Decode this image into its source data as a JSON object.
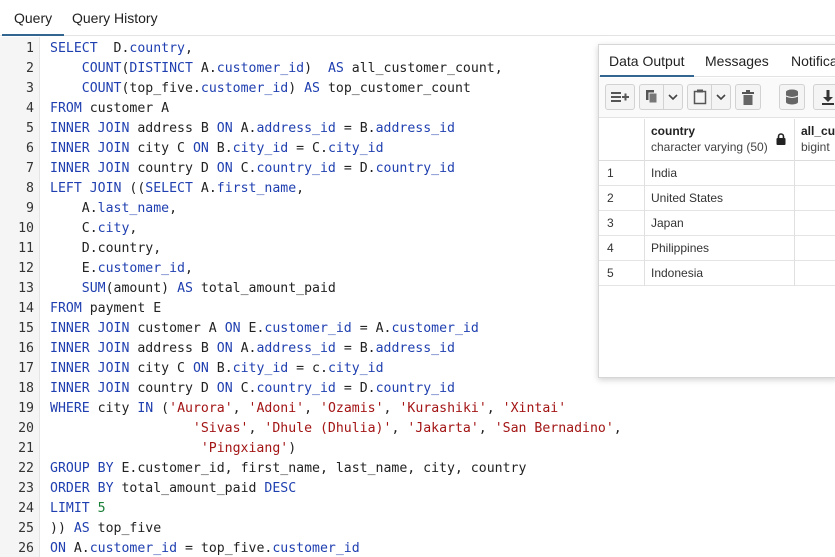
{
  "tabs": [
    {
      "label": "Query",
      "active": true
    },
    {
      "label": "Query History",
      "active": false
    }
  ],
  "editor": {
    "lines": [
      {
        "n": "1",
        "segs": [
          [
            "kw",
            "SELECT"
          ],
          [
            "",
            "  D."
          ],
          [
            "alias",
            "country"
          ],
          [
            "",
            ","
          ]
        ]
      },
      {
        "n": "2",
        "segs": [
          [
            "",
            "    "
          ],
          [
            "fn",
            "COUNT"
          ],
          [
            "",
            "("
          ],
          [
            "kw",
            "DISTINCT"
          ],
          [
            "",
            " A."
          ],
          [
            "alias",
            "customer_id"
          ],
          [
            "",
            ")  "
          ],
          [
            "kw",
            "AS"
          ],
          [
            "",
            " all_customer_count,"
          ]
        ]
      },
      {
        "n": "3",
        "segs": [
          [
            "",
            "    "
          ],
          [
            "fn",
            "COUNT"
          ],
          [
            "",
            "(top_five."
          ],
          [
            "alias",
            "customer_id"
          ],
          [
            "",
            ") "
          ],
          [
            "kw",
            "AS"
          ],
          [
            "",
            " top_customer_count"
          ]
        ]
      },
      {
        "n": "4",
        "segs": [
          [
            "kw",
            "FROM"
          ],
          [
            "",
            " customer A"
          ]
        ]
      },
      {
        "n": "5",
        "segs": [
          [
            "kw",
            "INNER JOIN"
          ],
          [
            "",
            " address B "
          ],
          [
            "kw",
            "ON"
          ],
          [
            "",
            " A."
          ],
          [
            "alias",
            "address_id"
          ],
          [
            "",
            " = B."
          ],
          [
            "alias",
            "address_id"
          ]
        ]
      },
      {
        "n": "6",
        "segs": [
          [
            "kw",
            "INNER JOIN"
          ],
          [
            "",
            " city C "
          ],
          [
            "kw",
            "ON"
          ],
          [
            "",
            " B."
          ],
          [
            "alias",
            "city_id"
          ],
          [
            "",
            " = C."
          ],
          [
            "alias",
            "city_id"
          ]
        ]
      },
      {
        "n": "7",
        "segs": [
          [
            "kw",
            "INNER JOIN"
          ],
          [
            "",
            " country D "
          ],
          [
            "kw",
            "ON"
          ],
          [
            "",
            " C."
          ],
          [
            "alias",
            "country_id"
          ],
          [
            "",
            " = D."
          ],
          [
            "alias",
            "country_id"
          ]
        ]
      },
      {
        "n": "8",
        "segs": [
          [
            "kw",
            "LEFT JOIN"
          ],
          [
            "",
            " (("
          ],
          [
            "kw",
            "SELECT"
          ],
          [
            "",
            " A."
          ],
          [
            "alias",
            "first_name"
          ],
          [
            "",
            ","
          ]
        ]
      },
      {
        "n": "9",
        "segs": [
          [
            "",
            "    A."
          ],
          [
            "alias",
            "last_name"
          ],
          [
            "",
            ","
          ]
        ]
      },
      {
        "n": "10",
        "segs": [
          [
            "",
            "    C."
          ],
          [
            "alias",
            "city"
          ],
          [
            "",
            ","
          ]
        ]
      },
      {
        "n": "11",
        "segs": [
          [
            "",
            "    D.country,"
          ]
        ]
      },
      {
        "n": "12",
        "segs": [
          [
            "",
            "    E."
          ],
          [
            "alias",
            "customer_id"
          ],
          [
            "",
            ","
          ]
        ]
      },
      {
        "n": "13",
        "segs": [
          [
            "",
            "    "
          ],
          [
            "fn",
            "SUM"
          ],
          [
            "",
            "(amount) "
          ],
          [
            "kw",
            "AS"
          ],
          [
            "",
            " total_amount_paid"
          ]
        ]
      },
      {
        "n": "14",
        "segs": [
          [
            "kw",
            "FROM"
          ],
          [
            "",
            " payment E"
          ]
        ]
      },
      {
        "n": "15",
        "segs": [
          [
            "kw",
            "INNER JOIN"
          ],
          [
            "",
            " customer A "
          ],
          [
            "kw",
            "ON"
          ],
          [
            "",
            " E."
          ],
          [
            "alias",
            "customer_id"
          ],
          [
            "",
            " = A."
          ],
          [
            "alias",
            "customer_id"
          ]
        ]
      },
      {
        "n": "16",
        "segs": [
          [
            "kw",
            "INNER JOIN"
          ],
          [
            "",
            " address B "
          ],
          [
            "kw",
            "ON"
          ],
          [
            "",
            " A."
          ],
          [
            "alias",
            "address_id"
          ],
          [
            "",
            " = B."
          ],
          [
            "alias",
            "address_id"
          ]
        ]
      },
      {
        "n": "17",
        "segs": [
          [
            "kw",
            "INNER JOIN"
          ],
          [
            "",
            " city C "
          ],
          [
            "kw",
            "ON"
          ],
          [
            "",
            " B."
          ],
          [
            "alias",
            "city_id"
          ],
          [
            "",
            " = c."
          ],
          [
            "alias",
            "city_id"
          ]
        ]
      },
      {
        "n": "18",
        "segs": [
          [
            "kw",
            "INNER JOIN"
          ],
          [
            "",
            " country D "
          ],
          [
            "kw",
            "ON"
          ],
          [
            "",
            " C."
          ],
          [
            "alias",
            "country_id"
          ],
          [
            "",
            " = D."
          ],
          [
            "alias",
            "country_id"
          ]
        ]
      },
      {
        "n": "19",
        "segs": [
          [
            "kw",
            "WHERE"
          ],
          [
            "",
            " city "
          ],
          [
            "kw",
            "IN"
          ],
          [
            "",
            " ("
          ],
          [
            "str",
            "'Aurora'"
          ],
          [
            ", "
          ],
          [
            "str",
            "'Adoni'"
          ],
          [
            ", "
          ],
          [
            "str",
            "'Ozamis'"
          ],
          [
            ", "
          ],
          [
            "str",
            "'Kurashiki'"
          ],
          [
            ", "
          ],
          [
            "str",
            "'Xintai'"
          ]
        ]
      },
      {
        "n": "20",
        "segs": [
          [
            "",
            "                  "
          ],
          [
            "str",
            "'Sivas'"
          ],
          [
            ", "
          ],
          [
            "str",
            "'Dhule (Dhulia)'"
          ],
          [
            ", "
          ],
          [
            "str",
            "'Jakarta'"
          ],
          [
            ", "
          ],
          [
            "str",
            "'San Bernadino'"
          ],
          [
            "",
            ","
          ]
        ]
      },
      {
        "n": "21",
        "segs": [
          [
            "",
            "                   "
          ],
          [
            "str",
            "'Pingxiang'"
          ],
          [
            "",
            ")"
          ]
        ]
      },
      {
        "n": "22",
        "segs": [
          [
            "kw",
            "GROUP BY"
          ],
          [
            "",
            " E.customer_id, first_name, last_name, city, country"
          ]
        ]
      },
      {
        "n": "23",
        "segs": [
          [
            "kw",
            "ORDER BY"
          ],
          [
            "",
            " total_amount_paid "
          ],
          [
            "kw",
            "DESC"
          ]
        ]
      },
      {
        "n": "24",
        "segs": [
          [
            "kw",
            "LIMIT"
          ],
          [
            "",
            " "
          ],
          [
            "num",
            "5"
          ]
        ]
      },
      {
        "n": "25",
        "segs": [
          [
            "",
            "))"
          ],
          [
            "",
            " "
          ],
          [
            "kw",
            "AS"
          ],
          [
            "",
            " top_five"
          ]
        ]
      },
      {
        "n": "26",
        "segs": [
          [
            "kw",
            "ON"
          ],
          [
            "",
            " A."
          ],
          [
            "alias",
            "customer_id"
          ],
          [
            "",
            " = top_five."
          ],
          [
            "alias",
            "customer_id"
          ]
        ]
      }
    ]
  },
  "output": {
    "tabs": [
      {
        "label": "Data Output",
        "active": true
      },
      {
        "label": "Messages",
        "active": false
      },
      {
        "label": "Notifica",
        "active": false
      }
    ],
    "toolbar": [
      "add-row-icon",
      "copy-icon",
      "dropdown-icon",
      "paste-icon",
      "dropdown-icon",
      "delete-icon",
      "save-data-icon",
      "download-icon"
    ],
    "columns": [
      {
        "name": "country",
        "type": "character varying (50)",
        "locked": true
      },
      {
        "name": "all_cus",
        "type": "bigint"
      }
    ],
    "rows": [
      {
        "n": "1",
        "country": "India"
      },
      {
        "n": "2",
        "country": "United States"
      },
      {
        "n": "3",
        "country": "Japan"
      },
      {
        "n": "4",
        "country": "Philippines"
      },
      {
        "n": "5",
        "country": "Indonesia"
      }
    ]
  },
  "colors": {
    "keyword": "#1f3fb0",
    "string": "#a31515",
    "number": "#1a7f37",
    "tab_underline": "#326690"
  }
}
